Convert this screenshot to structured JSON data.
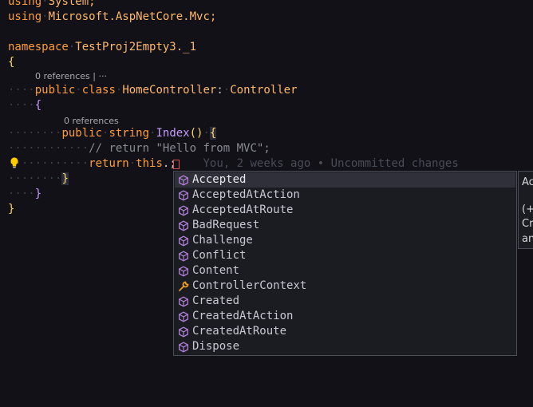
{
  "editor": {
    "lines": [
      {
        "kw": "using",
        "rest": "System;"
      },
      {
        "kw": "using",
        "rest": "Microsoft.AspNetCore.Mvc;"
      }
    ],
    "namespace_kw": "namespace",
    "namespace_name": "TestProj2Empty3._1",
    "open_brace": "{",
    "codelens_class": "0 references | ···",
    "public_kw": "public",
    "class_kw": "class",
    "class_name": "HomeController",
    "colon": ":",
    "base_class": "Controller",
    "codelens_method": "0 references",
    "string_kw": "string",
    "method_name": "Index",
    "parens": "()",
    "comment": "// return \"Hello from MVC\";",
    "return_kw": "return",
    "this_kw": "this",
    "dot_semi": ".;",
    "blame": "You, 2 weeks ago • Uncommitted changes",
    "close_brace": "}"
  },
  "suggestions": {
    "selected_index": 0,
    "items": [
      {
        "label": "Accepted",
        "icon": "cube-icon"
      },
      {
        "label": "AcceptedAtAction",
        "icon": "cube-icon"
      },
      {
        "label": "AcceptedAtRoute",
        "icon": "cube-icon"
      },
      {
        "label": "BadRequest",
        "icon": "cube-icon"
      },
      {
        "label": "Challenge",
        "icon": "cube-icon"
      },
      {
        "label": "Conflict",
        "icon": "cube-icon"
      },
      {
        "label": "Content",
        "icon": "cube-icon"
      },
      {
        "label": "ControllerContext",
        "icon": "wrench-icon"
      },
      {
        "label": "Created",
        "icon": "cube-icon"
      },
      {
        "label": "CreatedAtAction",
        "icon": "cube-icon"
      },
      {
        "label": "CreatedAtRoute",
        "icon": "cube-icon"
      },
      {
        "label": "Dispose",
        "icon": "cube-icon"
      }
    ]
  },
  "detail": {
    "title": "Ac",
    "sig": "(+",
    "desc1": "Cr",
    "desc2": "an"
  },
  "colors": {
    "cube": "#b180d7",
    "wrench": "#ee9d28",
    "bulb": "#ffcc00"
  }
}
